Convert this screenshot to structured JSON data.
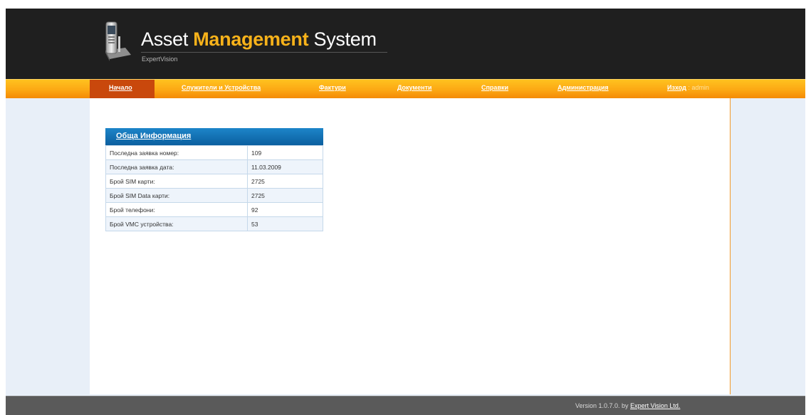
{
  "header": {
    "title_part1": "Asset ",
    "title_accent": "Management",
    "title_part2": " System",
    "subtitle": "ExpertVision",
    "accent_color": "#f7b21a"
  },
  "nav": {
    "items": [
      {
        "label": "Начало",
        "active": true
      },
      {
        "label": "Служители и Устройства"
      },
      {
        "label": "Фактури"
      },
      {
        "label": "Документи"
      },
      {
        "label": "Справки"
      },
      {
        "label": "Администрация"
      }
    ],
    "logout_label": "Изход",
    "logout_separator": " : ",
    "user": "admin"
  },
  "info_panel": {
    "title": "Обща Информация",
    "rows": [
      {
        "label": "Последна заявка номер:",
        "value": "109"
      },
      {
        "label": "Последна заявка дата:",
        "value": "11.03.2009"
      },
      {
        "label": "Брой SIM карти:",
        "value": "2725"
      },
      {
        "label": "Брой SIM Data карти:",
        "value": "2725"
      },
      {
        "label": "Брой телефони:",
        "value": "92"
      },
      {
        "label": "Брой VMC устройства:",
        "value": "53"
      }
    ]
  },
  "footer": {
    "version_text": "Version 1.0.7.0. by ",
    "company_link": "Expert Vision Ltd."
  }
}
